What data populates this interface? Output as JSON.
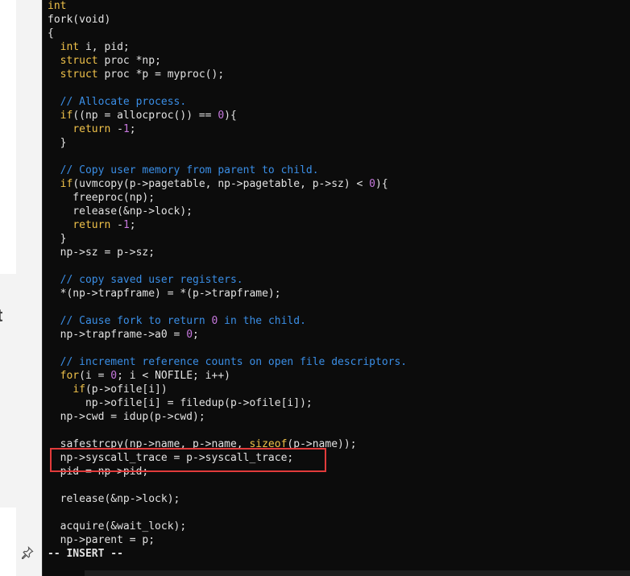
{
  "editor": {
    "mode_status": "-- INSERT --",
    "left_partial_glyph": "t",
    "pin_icon": "pin-icon",
    "highlight_color": "#e23b3b",
    "lines": [
      {
        "spans": [
          {
            "t": "int",
            "c": "ty"
          }
        ]
      },
      {
        "spans": [
          {
            "t": "fork(void)",
            "c": "plain"
          }
        ]
      },
      {
        "spans": [
          {
            "t": "{",
            "c": "plain"
          }
        ]
      },
      {
        "spans": [
          {
            "t": "  ",
            "c": "plain"
          },
          {
            "t": "int",
            "c": "ty"
          },
          {
            "t": " i, pid;",
            "c": "plain"
          }
        ]
      },
      {
        "spans": [
          {
            "t": "  ",
            "c": "plain"
          },
          {
            "t": "struct",
            "c": "ty"
          },
          {
            "t": " proc *np;",
            "c": "plain"
          }
        ]
      },
      {
        "spans": [
          {
            "t": "  ",
            "c": "plain"
          },
          {
            "t": "struct",
            "c": "ty"
          },
          {
            "t": " proc *p = myproc();",
            "c": "plain"
          }
        ]
      },
      {
        "spans": [
          {
            "t": "",
            "c": "plain"
          }
        ]
      },
      {
        "spans": [
          {
            "t": "  ",
            "c": "plain"
          },
          {
            "t": "// Allocate process.",
            "c": "cm"
          }
        ]
      },
      {
        "spans": [
          {
            "t": "  ",
            "c": "plain"
          },
          {
            "t": "if",
            "c": "kw"
          },
          {
            "t": "((np = allocproc()) == ",
            "c": "plain"
          },
          {
            "t": "0",
            "c": "num"
          },
          {
            "t": "){",
            "c": "plain"
          }
        ]
      },
      {
        "spans": [
          {
            "t": "    ",
            "c": "plain"
          },
          {
            "t": "return",
            "c": "kw"
          },
          {
            "t": " -",
            "c": "plain"
          },
          {
            "t": "1",
            "c": "num"
          },
          {
            "t": ";",
            "c": "plain"
          }
        ]
      },
      {
        "spans": [
          {
            "t": "  }",
            "c": "plain"
          }
        ]
      },
      {
        "spans": [
          {
            "t": "",
            "c": "plain"
          }
        ]
      },
      {
        "spans": [
          {
            "t": "  ",
            "c": "plain"
          },
          {
            "t": "// Copy user memory from parent to child.",
            "c": "cm"
          }
        ]
      },
      {
        "spans": [
          {
            "t": "  ",
            "c": "plain"
          },
          {
            "t": "if",
            "c": "kw"
          },
          {
            "t": "(uvmcopy(p->pagetable, np->pagetable, p->sz) < ",
            "c": "plain"
          },
          {
            "t": "0",
            "c": "num"
          },
          {
            "t": "){",
            "c": "plain"
          }
        ]
      },
      {
        "spans": [
          {
            "t": "    freeproc(np);",
            "c": "plain"
          }
        ]
      },
      {
        "spans": [
          {
            "t": "    release(&np->lock);",
            "c": "plain"
          }
        ]
      },
      {
        "spans": [
          {
            "t": "    ",
            "c": "plain"
          },
          {
            "t": "return",
            "c": "kw"
          },
          {
            "t": " -",
            "c": "plain"
          },
          {
            "t": "1",
            "c": "num"
          },
          {
            "t": ";",
            "c": "plain"
          }
        ]
      },
      {
        "spans": [
          {
            "t": "  }",
            "c": "plain"
          }
        ]
      },
      {
        "spans": [
          {
            "t": "  np->sz = p->sz;",
            "c": "plain"
          }
        ]
      },
      {
        "spans": [
          {
            "t": "",
            "c": "plain"
          }
        ]
      },
      {
        "spans": [
          {
            "t": "  ",
            "c": "plain"
          },
          {
            "t": "// copy saved user registers.",
            "c": "cm"
          }
        ]
      },
      {
        "spans": [
          {
            "t": "  *(np->trapframe) = *(p->trapframe);",
            "c": "plain"
          }
        ]
      },
      {
        "spans": [
          {
            "t": "",
            "c": "plain"
          }
        ]
      },
      {
        "spans": [
          {
            "t": "  ",
            "c": "plain"
          },
          {
            "t": "// Cause fork to return ",
            "c": "cm"
          },
          {
            "t": "0",
            "c": "num"
          },
          {
            "t": " in the child.",
            "c": "cm"
          }
        ]
      },
      {
        "spans": [
          {
            "t": "  np->trapframe->a0 = ",
            "c": "plain"
          },
          {
            "t": "0",
            "c": "num"
          },
          {
            "t": ";",
            "c": "plain"
          }
        ]
      },
      {
        "spans": [
          {
            "t": "",
            "c": "plain"
          }
        ]
      },
      {
        "spans": [
          {
            "t": "  ",
            "c": "plain"
          },
          {
            "t": "// increment reference counts on open file descriptors.",
            "c": "cm"
          }
        ]
      },
      {
        "spans": [
          {
            "t": "  ",
            "c": "plain"
          },
          {
            "t": "for",
            "c": "kw"
          },
          {
            "t": "(i = ",
            "c": "plain"
          },
          {
            "t": "0",
            "c": "num"
          },
          {
            "t": "; i < NOFILE; i++)",
            "c": "plain"
          }
        ]
      },
      {
        "spans": [
          {
            "t": "    ",
            "c": "plain"
          },
          {
            "t": "if",
            "c": "kw"
          },
          {
            "t": "(p->ofile[i])",
            "c": "plain"
          }
        ]
      },
      {
        "spans": [
          {
            "t": "      np->ofile[i] = filedup(p->ofile[i]);",
            "c": "plain"
          }
        ]
      },
      {
        "spans": [
          {
            "t": "  np->cwd = idup(p->cwd);",
            "c": "plain"
          }
        ]
      },
      {
        "spans": [
          {
            "t": "",
            "c": "plain"
          }
        ]
      },
      {
        "spans": [
          {
            "t": "  safestrcpy(np->name, p->name, ",
            "c": "plain"
          },
          {
            "t": "sizeof",
            "c": "kw"
          },
          {
            "t": "(p->name));",
            "c": "plain"
          }
        ]
      },
      {
        "spans": [
          {
            "t": "  np->syscall_trace = p->syscall_trace;",
            "c": "plain"
          }
        ]
      },
      {
        "spans": [
          {
            "t": "  pid = np->pid;",
            "c": "plain"
          }
        ]
      },
      {
        "spans": [
          {
            "t": "",
            "c": "plain"
          }
        ]
      },
      {
        "spans": [
          {
            "t": "  release(&np->lock);",
            "c": "plain"
          }
        ]
      },
      {
        "spans": [
          {
            "t": "",
            "c": "plain"
          }
        ]
      },
      {
        "spans": [
          {
            "t": "  acquire(&wait_lock);",
            "c": "plain"
          }
        ]
      },
      {
        "spans": [
          {
            "t": "  np->parent = p;",
            "c": "plain"
          }
        ]
      }
    ]
  }
}
